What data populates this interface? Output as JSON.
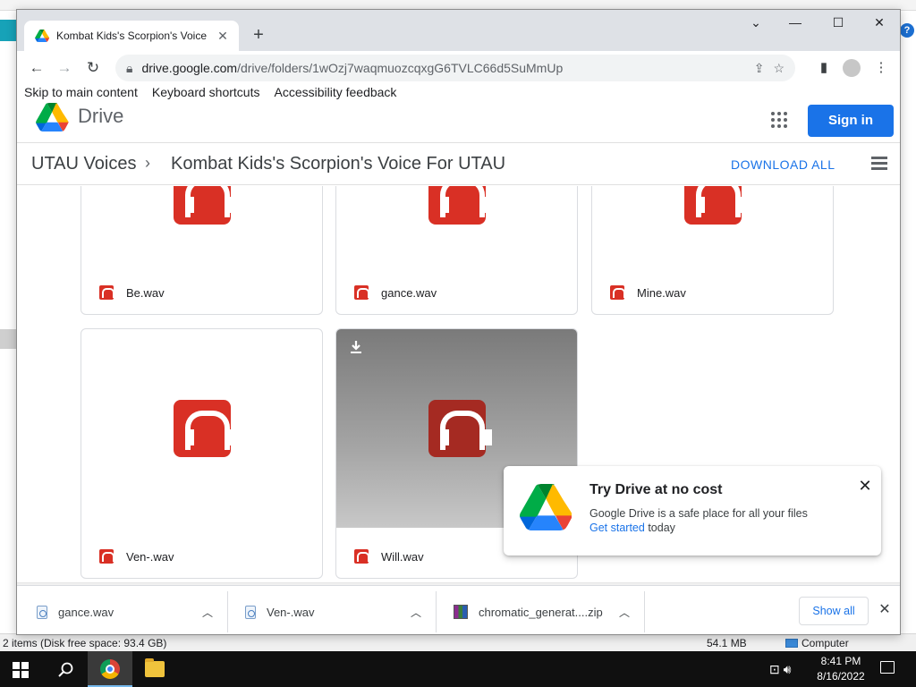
{
  "browser": {
    "tab_title": "Kombat Kids's Scorpion's Voice F",
    "new_tab_symbol": "+",
    "url_domain": "drive.google.com",
    "url_path": "/drive/folders/1wOzj7waqmuozcqxgG6TVLC66d5SuMmUp",
    "window_controls": {
      "chevron": "⌄",
      "minimize": "—",
      "maximize": "☐",
      "close": "✕"
    }
  },
  "skip_links": [
    "Skip to main content",
    "Keyboard shortcuts",
    "Accessibility feedback"
  ],
  "drive": {
    "product_name": "Drive",
    "signin_label": "Sign in",
    "breadcrumb_root": "UTAU Voices",
    "breadcrumb_current": "Kombat Kids's Scorpion's Voice For UTAU",
    "download_all_label": "DOWNLOAD ALL"
  },
  "files": [
    {
      "name": "Be.wav"
    },
    {
      "name": "gance.wav"
    },
    {
      "name": "Mine.wav"
    },
    {
      "name": "Ven-.wav"
    },
    {
      "name": "Will.wav"
    }
  ],
  "promo": {
    "title": "Try Drive at no cost",
    "description": "Google Drive is a safe place for all your files",
    "link_text": "Get started",
    "link_suffix": " today"
  },
  "downloads": {
    "items": [
      {
        "name": "gance.wav"
      },
      {
        "name": "Ven-.wav"
      },
      {
        "name": "chromatic_generat....zip"
      }
    ],
    "show_all_label": "Show all"
  },
  "background_window": {
    "status_left": "2 items (Disk free space: 93.4 GB)",
    "status_size": "54.1 MB",
    "status_location": "Computer"
  },
  "taskbar": {
    "time": "8:41 PM",
    "date": "8/16/2022"
  },
  "colors": {
    "accent_blue": "#1a73e8",
    "audio_red": "#d93025",
    "tab_strip": "#dee1e6"
  }
}
